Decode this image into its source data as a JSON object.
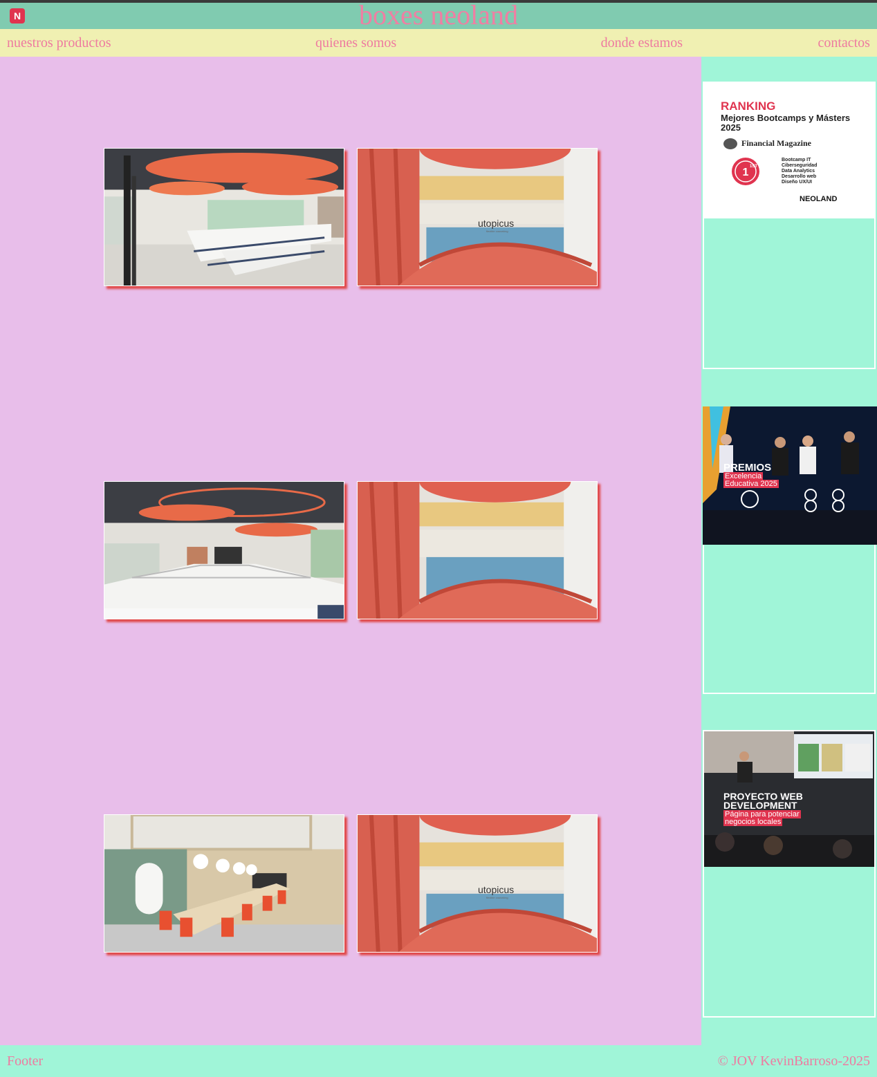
{
  "header": {
    "logo_letter": "N",
    "title": "boxes neoland"
  },
  "nav": {
    "items": [
      "nuestros productos",
      "quienes somos",
      "donde estamos",
      "contactos"
    ]
  },
  "gallery": {
    "photos": [
      {
        "scene": "classroom-orange-ceiling"
      },
      {
        "scene": "atrium-red-staircase",
        "caption": "utopicus",
        "caption_sub": "flexible coworking"
      },
      {
        "scene": "meeting-room-tables"
      },
      {
        "scene": "atrium-red-staircase"
      },
      {
        "scene": "boardroom-orange-chairs"
      },
      {
        "scene": "atrium-red-staircase",
        "caption": "utopicus",
        "caption_sub": "flexible coworking"
      }
    ]
  },
  "sidebar": {
    "ranking": {
      "heading": "RANKING",
      "subheading": "Mejores Bootcamps y Másters 2025",
      "magazine": "Financial Magazine",
      "badge": "1ST",
      "list": [
        "Bootcamp IT",
        "Ciberseguridad",
        "Data Analytics",
        "Desarrollo web",
        "Diseño UX/UI"
      ],
      "brand": "NEOLAND"
    },
    "premios": {
      "heading": "PREMIOS",
      "sub1": "Excelencia",
      "sub2": "Educativa 2025"
    },
    "proyecto": {
      "heading1": "PROYECTO WEB",
      "heading2": "DEVELOPMENT",
      "sub1": "Página para potenciar",
      "sub2": "negocios locales"
    }
  },
  "footer": {
    "left": "Footer",
    "right": "© JOV KevinBarroso-2025"
  },
  "colors": {
    "header_bg": "#80cbb0",
    "nav_bg": "#f0f0b2",
    "main_bg": "#e8beea",
    "sidebar_bg": "#a0f5d8",
    "text_accent": "#ee7aa0",
    "shadow": "#e04848"
  }
}
